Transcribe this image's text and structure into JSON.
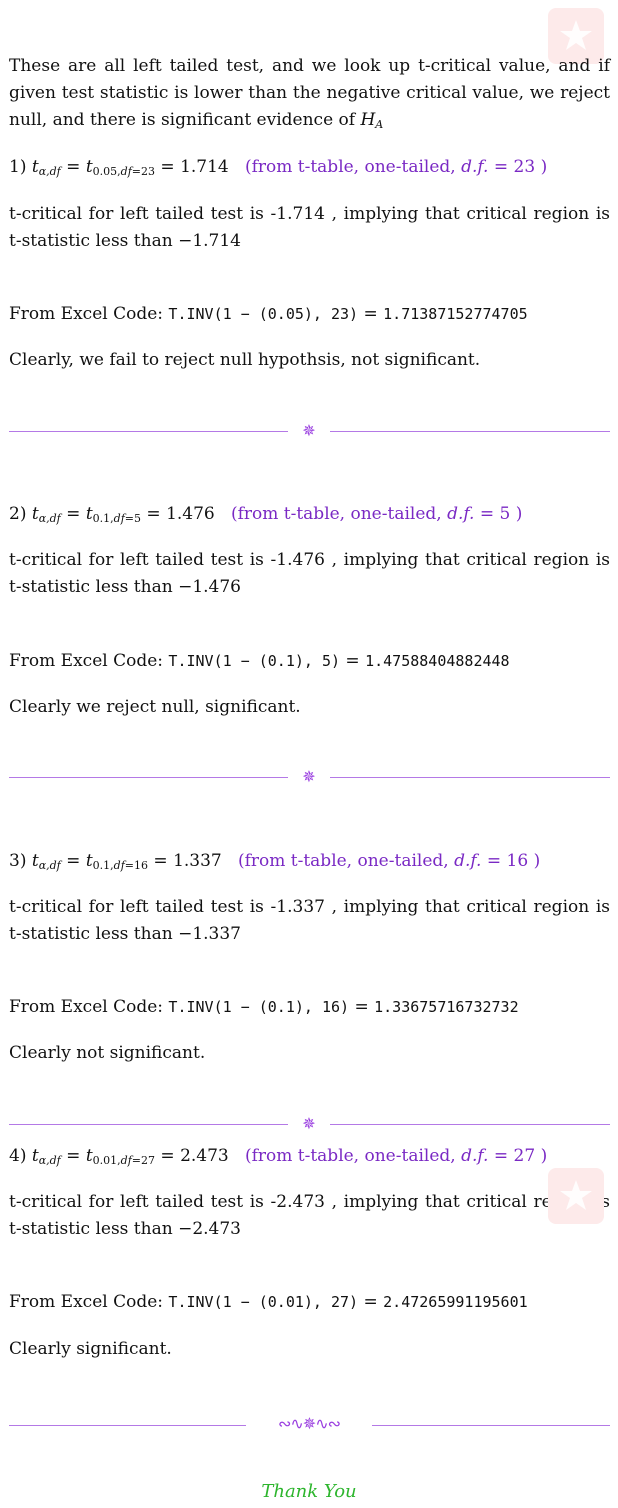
{
  "intro": "These are all left tailed test, and we look up t-critical value, and if given test statistic is lower than the negative critical value, we reject null, and there is significant evidence of",
  "intro_sym": "H",
  "intro_sub": "A",
  "problems": [
    {
      "num": "1)",
      "alpha": "0.05",
      "df": "23",
      "tval": "1.714",
      "note_df": "23",
      "tcrit_text": "t-critical for left tailed test is -1.714 , implying that critical region is t-statistic less than",
      "tcrit_val": "−1.714",
      "excel_args": "T.INV(1 − (0.05), 23)",
      "excel_result": "1.71387152774705",
      "conclusion": "Clearly, we fail to reject null hypothsis, not significant."
    },
    {
      "num": "2)",
      "alpha": "0.1",
      "df": "5",
      "tval": "1.476",
      "note_df": "5",
      "tcrit_text": "t-critical for left tailed test is -1.476 , implying that critical region is t-statistic less than",
      "tcrit_val": "−1.476",
      "excel_args": "T.INV(1 − (0.1), 5)",
      "excel_result": "1.47588404882448",
      "conclusion": "Clearly we reject null, significant."
    },
    {
      "num": "3)",
      "alpha": "0.1",
      "df": "16",
      "tval": "1.337",
      "note_df": "16",
      "tcrit_text": "t-critical for left tailed test is -1.337 , implying that critical region is t-statistic less than",
      "tcrit_val": "−1.337",
      "excel_args": "T.INV(1 − (0.1), 16)",
      "excel_result": "1.33675716732732",
      "conclusion": "Clearly not significant."
    },
    {
      "num": "4)",
      "alpha": "0.01",
      "df": "27",
      "tval": "2.473",
      "note_df": "27",
      "tcrit_text": "t-critical for left tailed test is -2.473 , implying that critical region is t-statistic less than",
      "tcrit_val": "−2.473",
      "excel_args": "T.INV(1 − (0.01), 27)",
      "excel_result": "2.47265991195601",
      "conclusion": "Clearly significant."
    }
  ],
  "labels": {
    "note_prefix": "(from t-table, one-tailed,",
    "note_dfsym": "d.f.",
    "note_suffix": ")",
    "excel_prefix": "From Excel Code:",
    "t_alpha_df": "t",
    "sub_generic": "α,df",
    "sub_df_prefix": "df="
  },
  "closing": "Thank You",
  "colors": {
    "accent": "#7a29c4",
    "rule": "#b479e6",
    "thanks": "#2db52d"
  }
}
